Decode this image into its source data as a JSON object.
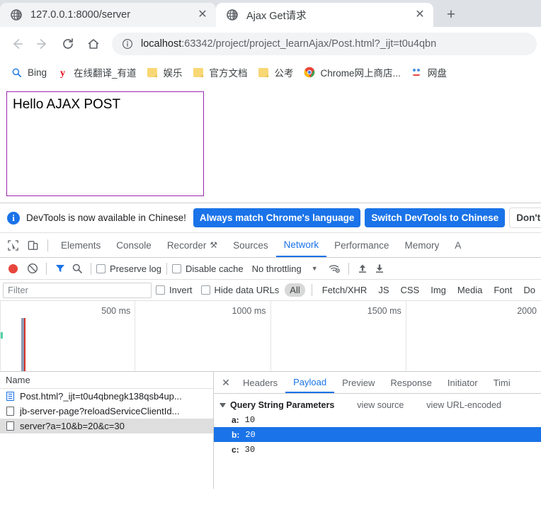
{
  "browser": {
    "tabs": [
      {
        "title": "127.0.0.1:8000/server",
        "favicon": "globe-icon",
        "active": false,
        "close_label": "✕"
      },
      {
        "title": "Ajax Get请求",
        "favicon": "globe-icon",
        "active": true,
        "close_label": "✕"
      }
    ],
    "new_tab_label": "+",
    "nav": {
      "back_label": "←",
      "forward_label": "→",
      "reload_label": "⟳",
      "home_label": "⌂"
    },
    "omnibox": {
      "info_icon": "info-circle-icon",
      "host": "localhost",
      "path": ":63342/project/project_learnAjax/Post.html?_ijt=t0u4qbn"
    },
    "bookmarks": [
      {
        "label": "Bing",
        "icon": "bing-search-icon"
      },
      {
        "label": "在线翻译_有道",
        "icon": "youdao-icon"
      },
      {
        "label": "娱乐",
        "icon": "folder-icon"
      },
      {
        "label": "官方文档",
        "icon": "folder-icon"
      },
      {
        "label": "公考",
        "icon": "folder-icon"
      },
      {
        "label": "Chrome网上商店...",
        "icon": "chrome-icon"
      },
      {
        "label": "网盘",
        "icon": "baidu-pan-icon"
      }
    ]
  },
  "page": {
    "result_text": "Hello AJAX POST",
    "box_border_color": "#9c27b0"
  },
  "devtools": {
    "notice": {
      "icon": "info-icon",
      "text": "DevTools is now available in Chinese!",
      "buttons": [
        {
          "label": "Always match Chrome's language",
          "style": "primary"
        },
        {
          "label": "Switch DevTools to Chinese",
          "style": "primary"
        },
        {
          "label": "Don't",
          "style": "plain"
        }
      ]
    },
    "panel_tabs": [
      {
        "label": "Elements",
        "selected": false
      },
      {
        "label": "Console",
        "selected": false
      },
      {
        "label": "Recorder",
        "selected": false,
        "badge": "flask-icon"
      },
      {
        "label": "Sources",
        "selected": false
      },
      {
        "label": "Network",
        "selected": true
      },
      {
        "label": "Performance",
        "selected": false
      },
      {
        "label": "Memory",
        "selected": false
      },
      {
        "label": "A",
        "selected": false
      }
    ],
    "inspect_icon": "cursor-inspect-icon",
    "device_icon": "device-toolbar-icon",
    "network_toolbar": {
      "record_icon": "record-dot-icon",
      "clear_icon": "clear-no-entry-icon",
      "filter_icon": "funnel-icon",
      "search_icon": "search-icon",
      "preserve_log_label": "Preserve log",
      "disable_cache_label": "Disable cache",
      "throttle_value": "No throttling",
      "throttle_caret": "▼",
      "wifi_settings_icon": "wifi-gear-icon",
      "upload_icon": "upload-arrow-icon",
      "download_icon": "download-arrow-icon"
    },
    "filter_bar": {
      "filter_placeholder": "Filter",
      "invert_label": "Invert",
      "hide_data_urls_label": "Hide data URLs",
      "types": [
        {
          "label": "All",
          "selected": true
        },
        {
          "label": "Fetch/XHR",
          "selected": false
        },
        {
          "label": "JS",
          "selected": false
        },
        {
          "label": "CSS",
          "selected": false
        },
        {
          "label": "Img",
          "selected": false
        },
        {
          "label": "Media",
          "selected": false
        },
        {
          "label": "Font",
          "selected": false
        },
        {
          "label": "Do",
          "selected": false
        }
      ]
    },
    "overview": {
      "ticks": [
        "500 ms",
        "1000 ms",
        "1500 ms",
        "2000"
      ]
    },
    "requests": {
      "column_header": "Name",
      "rows": [
        {
          "name": "Post.html?_ijt=t0u4qbnegk138qsb4up...",
          "icon": "document-icon",
          "selected": false
        },
        {
          "name": "jb-server-page?reloadServiceClientId...",
          "icon": "file-icon",
          "selected": false
        },
        {
          "name": "server?a=10&b=20&c=30",
          "icon": "file-icon",
          "selected": true
        }
      ]
    },
    "detail": {
      "close_label": "✕",
      "tabs": [
        {
          "label": "Headers",
          "selected": false
        },
        {
          "label": "Payload",
          "selected": true
        },
        {
          "label": "Preview",
          "selected": false
        },
        {
          "label": "Response",
          "selected": false
        },
        {
          "label": "Initiator",
          "selected": false
        },
        {
          "label": "Timi",
          "selected": false
        }
      ],
      "query_string": {
        "title": "Query String Parameters",
        "view_source_label": "view source",
        "view_url_encoded_label": "view URL-encoded",
        "params": [
          {
            "key": "a:",
            "value": "10",
            "selected": false
          },
          {
            "key": "b:",
            "value": "20",
            "selected": true
          },
          {
            "key": "c:",
            "value": "30",
            "selected": false
          }
        ]
      }
    }
  }
}
